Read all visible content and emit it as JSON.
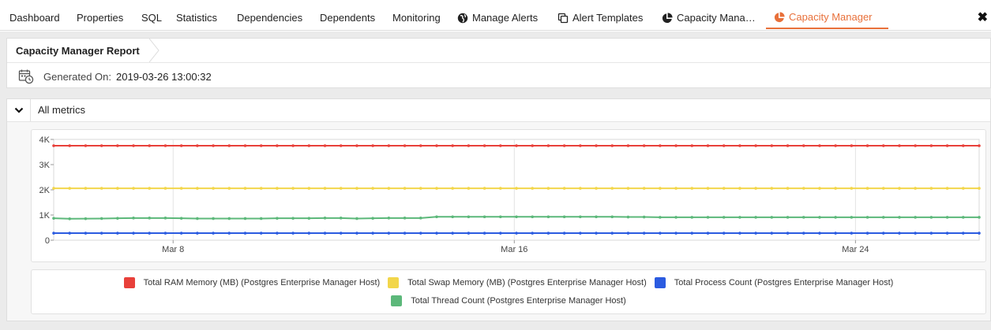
{
  "tabs": [
    {
      "label": "Dashboard",
      "icon": ""
    },
    {
      "label": "Properties",
      "icon": ""
    },
    {
      "label": "SQL",
      "icon": ""
    },
    {
      "label": "Statistics",
      "icon": ""
    },
    {
      "label": "Dependencies",
      "icon": ""
    },
    {
      "label": "Dependents",
      "icon": ""
    },
    {
      "label": "Monitoring",
      "icon": ""
    },
    {
      "label": "Manage Alerts",
      "icon": "globe-icon"
    },
    {
      "label": "Alert Templates",
      "icon": "copy-icon"
    },
    {
      "label": "Capacity Mana…",
      "icon": "pie-chart-icon"
    },
    {
      "label": "Capacity Manager",
      "icon": "pie-chart-icon",
      "active": true
    }
  ],
  "close_label": "✖",
  "report": {
    "title": "Capacity Manager Report",
    "generated_label": "Generated On:",
    "generated_value": "2019-03-26 13:00:32"
  },
  "section": {
    "title": "All metrics",
    "expanded": true
  },
  "colors": {
    "accent": "#e8703a",
    "ram": "#e8403a",
    "swap": "#f2d64b",
    "process": "#2b5be0",
    "thread": "#5cb87a"
  },
  "chart_data": {
    "type": "line",
    "y_ticks": [
      "0",
      "1K",
      "2K",
      "3K",
      "4K"
    ],
    "ylim": [
      0,
      4000
    ],
    "x_tick_labels": [
      "Mar 8",
      "Mar 16",
      "Mar 24"
    ],
    "x_tick_days": [
      8,
      16,
      24
    ],
    "xlim_days": [
      5.2,
      26.9
    ],
    "grid": true,
    "legend_position": "bottom",
    "series": [
      {
        "name": "Total RAM Memory (MB) (Postgres Enterprise Manager Host)",
        "color": "#e8403a",
        "values": [
          3750
        ]
      },
      {
        "name": "Total Swap Memory (MB) (Postgres Enterprise Manager Host)",
        "color": "#f2d64b",
        "values": [
          2060
        ]
      },
      {
        "name": "Total Process Count (Postgres Enterprise Manager Host)",
        "color": "#2b5be0",
        "values": [
          280
        ]
      },
      {
        "name": "Total Thread Count (Postgres Enterprise Manager Host)",
        "color": "#5cb87a",
        "values": [
          870,
          850,
          855,
          860,
          870,
          880,
          880,
          880,
          870,
          860,
          860,
          860,
          860,
          860,
          870,
          870,
          870,
          880,
          880,
          860,
          870,
          880,
          880,
          880,
          930,
          930,
          930,
          930,
          930,
          930,
          930,
          930,
          930,
          930,
          930,
          930,
          920,
          920,
          910,
          910,
          910,
          910,
          910,
          910,
          910,
          910,
          910,
          910,
          910,
          910,
          910,
          910,
          910,
          910,
          910,
          910,
          910,
          910,
          910
        ]
      }
    ]
  }
}
